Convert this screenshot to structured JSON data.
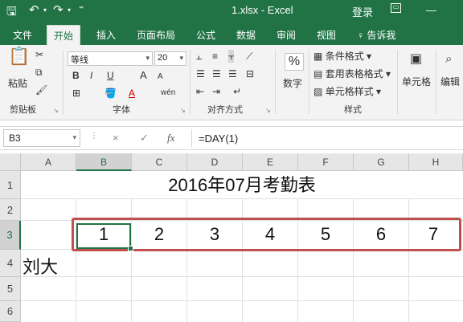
{
  "titlebar": {
    "filename": "1.xlsx - Excel",
    "login": "登录",
    "save_icon": "save-icon",
    "undo_icon": "undo-icon",
    "redo_icon": "redo-icon",
    "customize_icon": "qat-customize-icon",
    "ribbon_display_icon": "ribbon-display-icon",
    "minimize": "—"
  },
  "tabs": [
    "文件",
    "开始",
    "插入",
    "页面布局",
    "公式",
    "数据",
    "审阅",
    "视图"
  ],
  "tell_me": "告诉我",
  "ribbon": {
    "clipboard": {
      "paste": "粘贴",
      "label": "剪贴板"
    },
    "font": {
      "name": "等线",
      "size": "20",
      "label": "字体",
      "bold": "B",
      "italic": "I",
      "underline": "U",
      "grow": "A",
      "shrink": "A",
      "font_color": "A",
      "phonetic": "wén"
    },
    "alignment": {
      "label": "对齐方式"
    },
    "number": {
      "percent": "%",
      "label": "数字"
    },
    "styles": {
      "conditional": "条件格式",
      "table": "套用表格格式",
      "cell": "单元格样式",
      "label": "样式"
    },
    "cells": {
      "label": "单元格"
    },
    "editing": {
      "label": "编辑"
    }
  },
  "formula_bar": {
    "name_box": "B3",
    "cancel": "×",
    "enter": "✓",
    "fx": "fx",
    "formula": "=DAY(1)"
  },
  "sheet": {
    "columns": [
      "A",
      "B",
      "C",
      "D",
      "E",
      "F",
      "G",
      "H"
    ],
    "rows": [
      "1",
      "2",
      "3",
      "4",
      "5",
      "6"
    ],
    "selected_column": "B",
    "selected_row": "3",
    "title": "2016年07月考勤表",
    "day_numbers": [
      "1",
      "2",
      "3",
      "4",
      "5",
      "6",
      "7"
    ],
    "name_a4": "刘大"
  },
  "colors": {
    "excel_green": "#217346",
    "highlight_red": "#c0504d"
  }
}
